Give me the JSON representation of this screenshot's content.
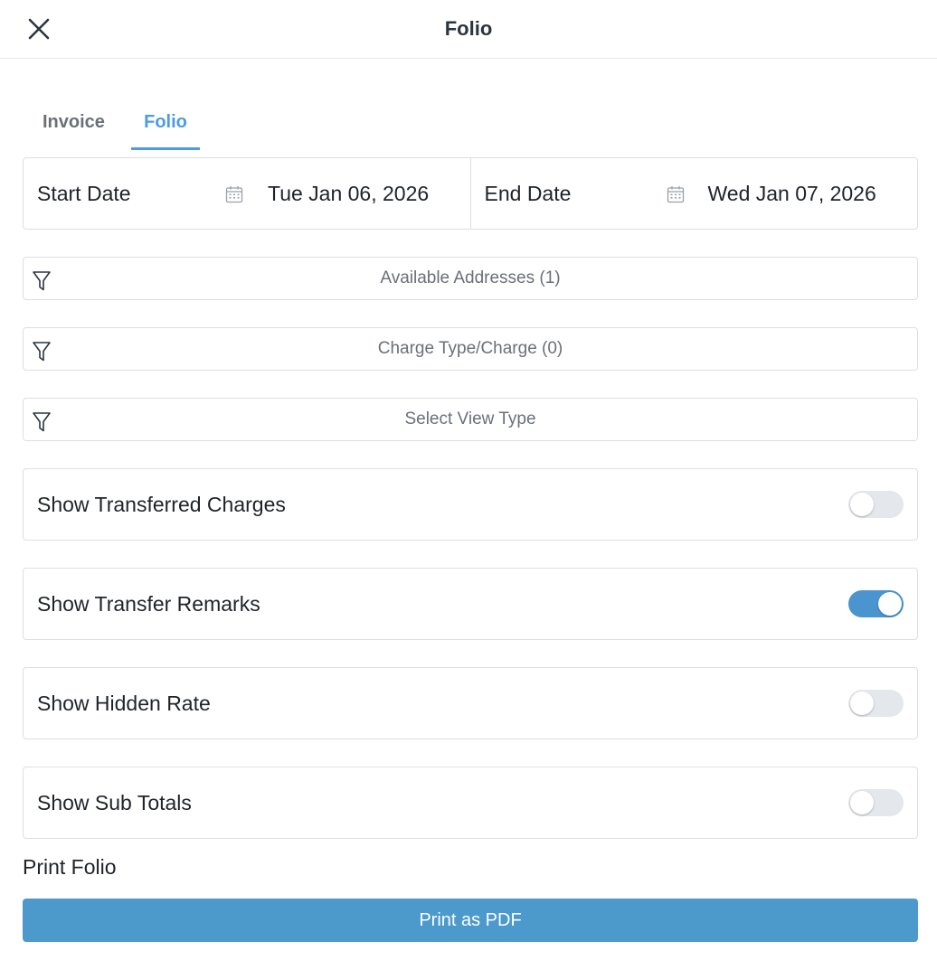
{
  "header": {
    "title": "Folio",
    "close_icon": "close-icon"
  },
  "tabs": [
    {
      "label": "Invoice",
      "active": false
    },
    {
      "label": "Folio",
      "active": true
    }
  ],
  "dates": {
    "start": {
      "label": "Start Date",
      "value": "Tue Jan 06, 2026",
      "icon": "calendar-icon"
    },
    "end": {
      "label": "End Date",
      "value": "Wed Jan 07, 2026",
      "icon": "calendar-icon"
    }
  },
  "filters": [
    {
      "label": "Available Addresses (1)",
      "icon": "filter-icon"
    },
    {
      "label": "Charge Type/Charge (0)",
      "icon": "filter-icon"
    },
    {
      "label": "Select View Type",
      "icon": "filter-icon"
    }
  ],
  "toggles": [
    {
      "label": "Show Transferred Charges",
      "on": false
    },
    {
      "label": "Show Transfer Remarks",
      "on": true
    },
    {
      "label": "Show Hidden Rate",
      "on": false
    },
    {
      "label": "Show Sub Totals",
      "on": false
    }
  ],
  "print": {
    "section_label": "Print Folio",
    "button_label": "Print as PDF"
  },
  "colors": {
    "accent": "#4d9be6",
    "toggle_on": "#4a94cf",
    "button": "#4c9acb",
    "border": "#dcdfe3"
  }
}
